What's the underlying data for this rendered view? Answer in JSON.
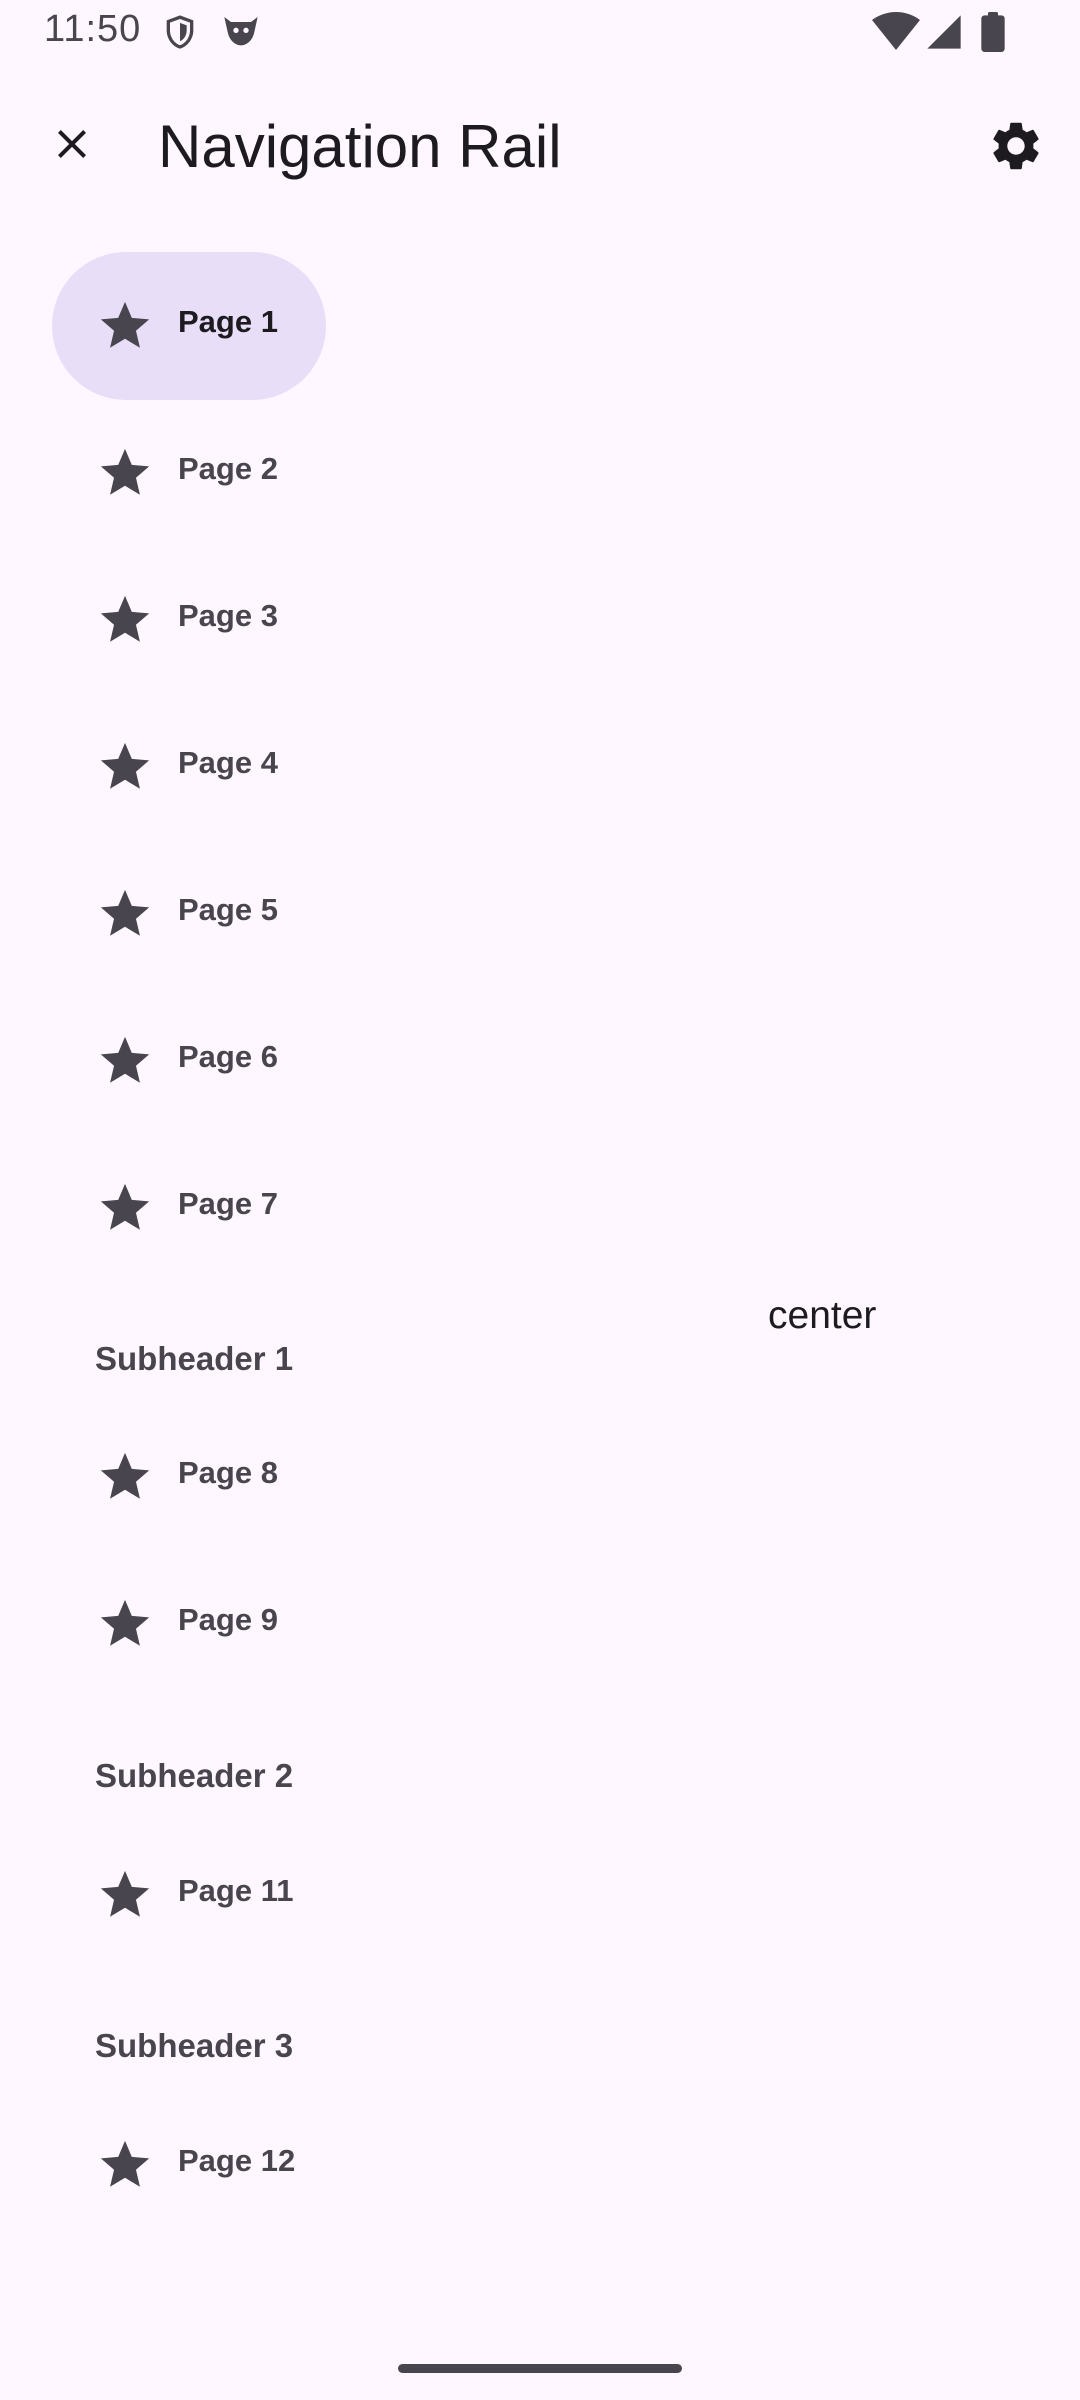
{
  "status_bar": {
    "time": "11:50",
    "left_icons": [
      "shield-icon",
      "cat-face-icon"
    ],
    "right_icons": [
      "wifi-icon",
      "cellular-signal-icon",
      "battery-icon"
    ]
  },
  "top_bar": {
    "close_icon": "close-icon",
    "title": "Navigation Rail",
    "settings_icon": "gear-icon"
  },
  "nav": {
    "items": [
      {
        "label": "Page 1",
        "icon": "star-icon",
        "active": true
      },
      {
        "label": "Page 2",
        "icon": "star-icon"
      },
      {
        "label": "Page 3",
        "icon": "star-icon"
      },
      {
        "label": "Page 4",
        "icon": "star-icon"
      },
      {
        "label": "Page 5",
        "icon": "star-icon"
      },
      {
        "label": "Page 6",
        "icon": "star-icon"
      },
      {
        "label": "Page 7",
        "icon": "star-icon"
      },
      {
        "label": "Page 8",
        "icon": "star-icon"
      },
      {
        "label": "Page 9",
        "icon": "star-icon"
      },
      {
        "label": "Page 11",
        "icon": "star-icon"
      },
      {
        "label": "Page 12",
        "icon": "star-icon"
      }
    ],
    "subheaders": [
      "Subheader 1",
      "Subheader 2",
      "Subheader 3"
    ]
  },
  "content": {
    "center_text": "center"
  },
  "colors": {
    "background": "#FEF7FF",
    "active_indicator": "#E8DEF8",
    "icon": "#49454F",
    "text": "#1D1B20"
  }
}
